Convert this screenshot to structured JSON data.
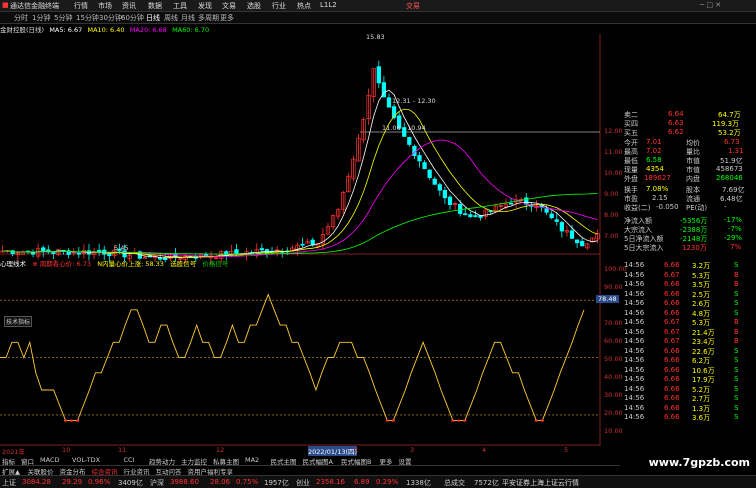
{
  "titlebar": {
    "app": "通达信金融终端",
    "menus": [
      "行情",
      "市场",
      "资讯",
      "数据",
      "工具",
      "发现",
      "文易",
      "选股",
      "行业",
      "热点",
      "L1L2"
    ],
    "right_link": "交易"
  },
  "toolbar": {
    "periods": [
      "分时",
      "1分钟",
      "5分钟",
      "15分钟",
      "30分钟",
      "60分钟",
      "日线",
      "周线",
      "月线",
      "多周期",
      "更多"
    ]
  },
  "stock": {
    "name": "金财控股(日线)"
  },
  "ma_legend": [
    {
      "label": "MA5: 6.67",
      "color": "#ffffff"
    },
    {
      "label": "MA10: 6.40",
      "color": "#ffff00"
    },
    {
      "label": "MA20: 6.68",
      "color": "#ff00ff"
    },
    {
      "label": "MA60: 6.70",
      "color": "#00ff00"
    }
  ],
  "price_axis": [
    "12.00",
    "11.00",
    "10.00",
    "9.00",
    "8.00",
    "7.00",
    "6.00"
  ],
  "annotations": {
    "high": "15.83",
    "mid": "12.31 - 12.30",
    "low_ann": "11.06 - 10.94",
    "low": "5.45"
  },
  "sub_legend": [
    {
      "label": "心理线术",
      "color": "#ffffff"
    },
    {
      "label": "⊕ 周期看心价: 6.73",
      "color": "#ff3333"
    },
    {
      "label": "N内量心价上涨: 58.33",
      "color": "#ffff00"
    },
    {
      "label": "选股信号",
      "color": "#ffff00"
    },
    {
      "label": "价格信号",
      "color": "#00cc00"
    }
  ],
  "sub_axis": [
    "100.00",
    "90.00",
    "80.00",
    "70.00",
    "60.00",
    "50.00",
    "40.00",
    "30.00",
    "20.00",
    "10.00"
  ],
  "sub_current": "78.48",
  "sub_indicator_tag": "技术指标",
  "quote": {
    "levels": [
      {
        "label": "卖二",
        "price": "6.64",
        "vol": "64.7万"
      },
      {
        "label": "买四",
        "price": "6.63",
        "vol": "119.3万"
      },
      {
        "label": "买五",
        "price": "6.62",
        "vol": "53.2万"
      }
    ],
    "stats": [
      {
        "l1": "今开",
        "v1": "7.01",
        "l2": "均价",
        "v2": "6.73"
      },
      {
        "l1": "最高",
        "v1": "7.02",
        "l2": "量比",
        "v2": "1.31"
      },
      {
        "l1": "最低",
        "v1": "6.58",
        "l2": "市值",
        "v2": "51.9亿"
      },
      {
        "l1": "现量",
        "v1": "4354",
        "l2": "市值",
        "v2": "458673"
      },
      {
        "l1": "外盘",
        "v1": "189627",
        "l2": "内盘",
        "v2": "268046"
      },
      {
        "l1": "换手",
        "v1": "7.08%",
        "l2": "股本",
        "v2": "7.69亿"
      },
      {
        "l1": "市盈",
        "v1": "2.15",
        "l2": "流通",
        "v2": "6.48亿"
      },
      {
        "l1": "收益(二)",
        "v1": "-0.050",
        "l2": "PE(动)",
        "v2": "-"
      }
    ],
    "flows": [
      {
        "label": "净流入额",
        "value": "-5356万",
        "pct": "-17%"
      },
      {
        "label": "大宗流入",
        "value": "-2388万",
        "pct": "-7%"
      },
      {
        "label": "5日净流入额",
        "value": "-2148万",
        "pct": "-29%"
      },
      {
        "label": "5日大宗流入",
        "value": "1230万",
        "pct": "7%"
      }
    ],
    "ticks": [
      {
        "t": "14:56",
        "p": "6.66",
        "v": "3.2万",
        "d": "S"
      },
      {
        "t": "14:56",
        "p": "6.67",
        "v": "5.3万",
        "d": "B"
      },
      {
        "t": "14:56",
        "p": "6.66",
        "v": "3.5万",
        "d": "B"
      },
      {
        "t": "14:56",
        "p": "6.66",
        "v": "2.5万",
        "d": "S"
      },
      {
        "t": "14:56",
        "p": "6.66",
        "v": "2.6万",
        "d": "S"
      },
      {
        "t": "14:56",
        "p": "6.66",
        "v": "4.8万",
        "d": "S"
      },
      {
        "t": "14:56",
        "p": "6.67",
        "v": "5.3万",
        "d": "B"
      },
      {
        "t": "14:56",
        "p": "6.67",
        "v": "21.4万",
        "d": "B"
      },
      {
        "t": "14:56",
        "p": "6.67",
        "v": "23.4万",
        "d": "B"
      },
      {
        "t": "14:56",
        "p": "6.66",
        "v": "22.6万",
        "d": "S"
      },
      {
        "t": "14:56",
        "p": "6.66",
        "v": "6.2万",
        "d": "S"
      },
      {
        "t": "14:56",
        "p": "6.66",
        "v": "10.6万",
        "d": "S"
      },
      {
        "t": "14:56",
        "p": "6.66",
        "v": "17.9万",
        "d": "S"
      },
      {
        "t": "14:56",
        "p": "6.66",
        "v": "5.2万",
        "d": "S"
      },
      {
        "t": "14:56",
        "p": "6.66",
        "v": "2.7万",
        "d": "S"
      },
      {
        "t": "14:56",
        "p": "6.66",
        "v": "1.3万",
        "d": "S"
      },
      {
        "t": "14:56",
        "p": "6.66",
        "v": "3.6万",
        "d": "S"
      }
    ]
  },
  "timeline": {
    "labels": [
      "2021年",
      "10",
      "11",
      "12",
      "2022/01/13(四)",
      "2",
      "3",
      "4",
      "5"
    ]
  },
  "bottom_tabs": [
    "指标",
    "窗口",
    "MACD",
    "VOL-TDX",
    "CCI",
    "趋势动力",
    "主力监控",
    "私募主图",
    "MA2",
    "民式主图",
    "民式幅图A",
    "民式幅图B",
    "更多",
    "设置"
  ],
  "bottom_tabs2": [
    "扩展▲",
    "关联股价",
    "资金分布",
    "综合资讯",
    "行业资讯",
    "互动问答",
    "资用户福利专享"
  ],
  "status": {
    "sh_label": "上证",
    "sh_val": "3084.28",
    "sh_chg": "29.29",
    "sh_pct": "0.96%",
    "sh_amt": "3409亿",
    "sz_label": "沪深",
    "sz_val": "3988.60",
    "sz_chg": "28.06",
    "sz_pct": "0.75%",
    "sz_amt": "1957亿",
    "cy_label": "创业",
    "cy_val": "2358.16",
    "cy_chg": "6.89",
    "cy_pct": "0.29%",
    "cy_amt": "1338亿",
    "total": "总成交",
    "total_val": "7572亿",
    "news": "平安证券上海上证云行情"
  },
  "watermark": "www.7gpzb.com",
  "colors": {
    "up": "#ff3333",
    "down": "#00ffff",
    "ma5": "#ffffff",
    "ma10": "#ffff00",
    "ma20": "#ff00ff",
    "ma60": "#00ff00",
    "osc": "#ffcc33"
  }
}
